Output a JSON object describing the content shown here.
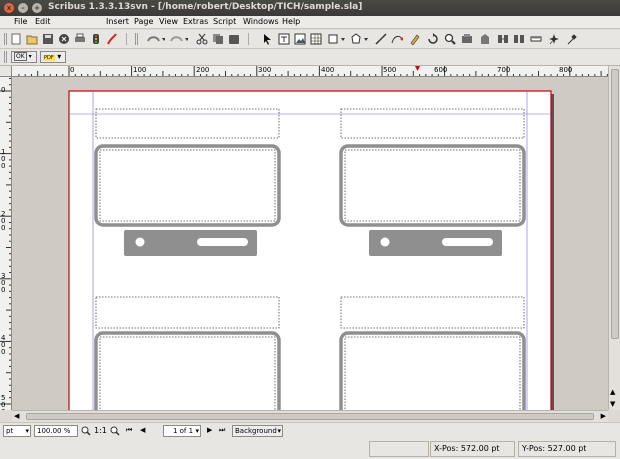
{
  "window": {
    "title": "Scribus 1.3.3.13svn - [/home/robert/Desktop/TICH/sample.sla]",
    "close_glyph": "x",
    "minimize_glyph": "–",
    "maximize_glyph": "+"
  },
  "menubar": {
    "items": [
      "File",
      "Edit",
      "Insert",
      "Page",
      "View",
      "Extras",
      "Script",
      "Windows",
      "Help"
    ]
  },
  "toolbar": {
    "icons": [
      "new-icon",
      "open-icon",
      "save-icon",
      "close-doc-icon",
      "print-icon",
      "preflight-icon",
      "export-pdf-icon",
      "undo-icon",
      "redo-icon",
      "cut-icon",
      "copy-icon",
      "paste-icon",
      "select-icon",
      "text-frame-icon",
      "image-frame-icon",
      "table-icon",
      "shape-icon",
      "polygon-icon",
      "line-icon",
      "bezier-icon",
      "freehand-icon",
      "rotate-icon",
      "zoom-icon",
      "edit-contents-icon",
      "edit-text-icon",
      "link-frames-icon",
      "unlink-frames-icon",
      "measure-icon",
      "copy-properties-icon",
      "eyedropper-icon"
    ]
  },
  "toolbar2": {
    "ok_label": "OK",
    "pdf_label": "PDF"
  },
  "ruler": {
    "h_ticks": [
      "0",
      "100",
      "200",
      "300",
      "400",
      "500",
      "600",
      "700",
      "800"
    ],
    "v_ticks": [
      "0",
      "100",
      "200",
      "300",
      "400",
      "500"
    ]
  },
  "statusctl": {
    "unit": "pt",
    "zoom": "100.00 %",
    "ratio": "1:1",
    "page": "1 of 1",
    "layer": "Background"
  },
  "status": {
    "xpos_label": "X-Pos:",
    "xpos_value": "572.00 pt",
    "ypos_label": "Y-Pos:",
    "ypos_value": "527.00 pt"
  },
  "colors": {
    "page_border": "#c8000a",
    "frame_gray": "#8f8f8f",
    "guide": "#6f6fd6"
  }
}
